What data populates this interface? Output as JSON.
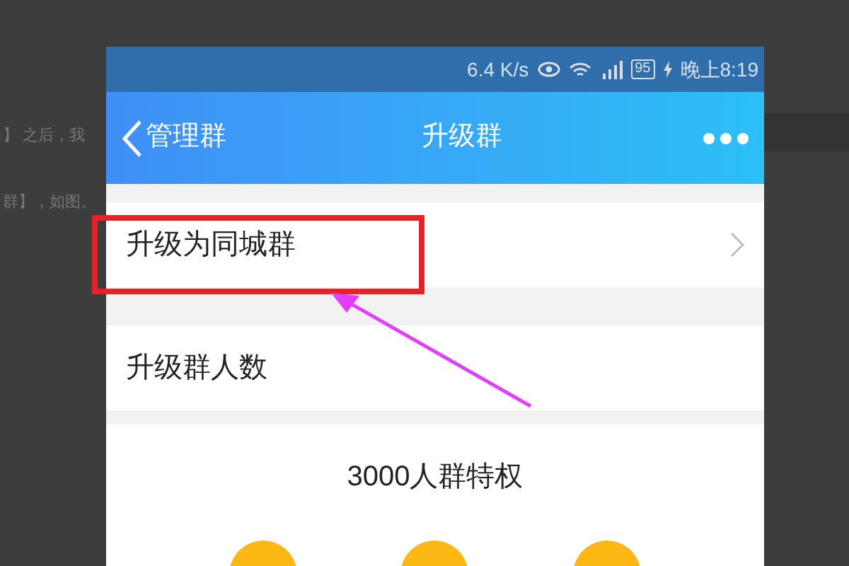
{
  "background_text": [
    "】 之后，我",
    "群】，如图。"
  ],
  "status_bar": {
    "speed": "6.4 K/s",
    "battery": "95",
    "time": "晚上8:19"
  },
  "nav_bar": {
    "back": "管理群",
    "title": "升级群"
  },
  "rows": [
    {
      "label": "升级为同城群",
      "chevron": true,
      "highlighted": true
    },
    {
      "label": "升级群人数",
      "chevron": false,
      "highlighted": false
    }
  ],
  "privilege": {
    "title": "3000人群特权"
  }
}
